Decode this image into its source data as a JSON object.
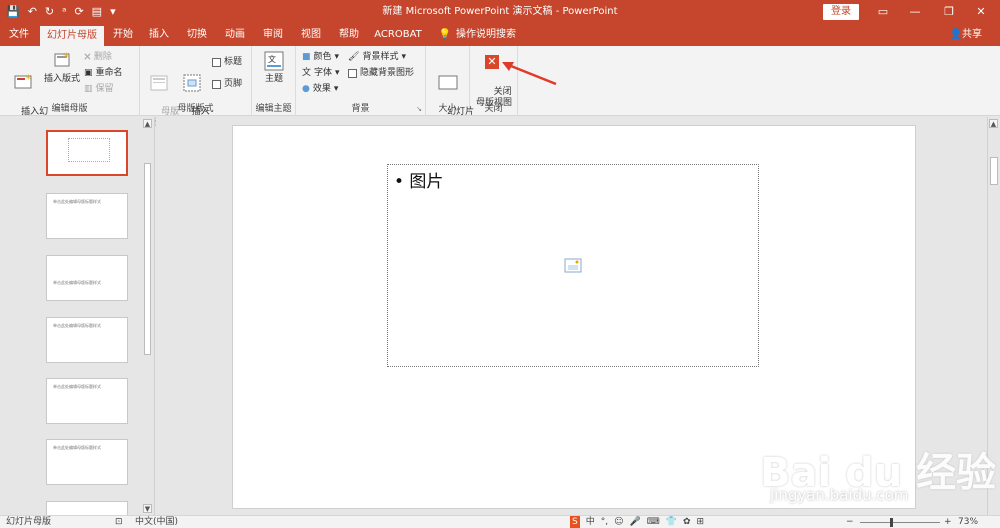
{
  "titlebar": {
    "doc_title": "新建 Microsoft PowerPoint 演示文稿 - PowerPoint",
    "login": "登录",
    "qat_icons": [
      "save-icon",
      "undo-icon",
      "redo-icon",
      "spell-icon",
      "reset-icon",
      "layout-icon"
    ]
  },
  "tabs": [
    {
      "label": "文件"
    },
    {
      "label": "幻灯片母版"
    },
    {
      "label": "开始"
    },
    {
      "label": "插入"
    },
    {
      "label": "切换"
    },
    {
      "label": "动画"
    },
    {
      "label": "审阅"
    },
    {
      "label": "视图"
    },
    {
      "label": "帮助"
    },
    {
      "label": "ACROBAT"
    },
    {
      "label": "操作说明搜索"
    }
  ],
  "share": "共享",
  "ribbon": {
    "edit_master": {
      "label": "编辑母版",
      "insert_master": "插入幻\n灯片母版",
      "insert_layout": "插入版式",
      "delete": "删除",
      "rename": "重命名",
      "preserve": "保留"
    },
    "master_layout": {
      "label": "母版版式",
      "master_layout_btn": "母版\n版式",
      "insert_placeholder": "插入\n占位符",
      "title_chk": "标题",
      "footer_chk": "页脚"
    },
    "edit_theme": {
      "label": "编辑主题",
      "theme": "主题"
    },
    "background": {
      "label": "背景",
      "colors": "颜色",
      "fonts": "字体",
      "effects": "效果",
      "bg_styles": "背景样式",
      "hide_bg": "隐藏背景图形"
    },
    "size": {
      "label": "大小",
      "slide_size": "幻灯片\n大小"
    },
    "close": {
      "label": "关闭",
      "close_master": "关闭\n母版视图"
    }
  },
  "thumbnails": [
    {
      "text": ""
    },
    {
      "text": "单击此处编辑母版标题样式"
    },
    {
      "text": "单击此处编辑母版标题样式"
    },
    {
      "text": "单击此处编辑母版标题样式"
    },
    {
      "text": "单击此处编辑母版标题样式"
    },
    {
      "text": "单击此处编辑母版标题样式"
    }
  ],
  "slide": {
    "placeholder_text": "• 图片"
  },
  "status": {
    "view": "幻灯片母版",
    "lang": "中文(中国)",
    "zoom": "73%"
  },
  "ime": [
    "中",
    "°,",
    "☺",
    "🎤",
    "⌨",
    "👕",
    "✿",
    "⊞"
  ],
  "watermark": {
    "brand": "Bai du 经验",
    "url": "jingyan.baidu.com"
  },
  "colors": {
    "accent": "#c5462c",
    "close_red": "#d9472b"
  }
}
